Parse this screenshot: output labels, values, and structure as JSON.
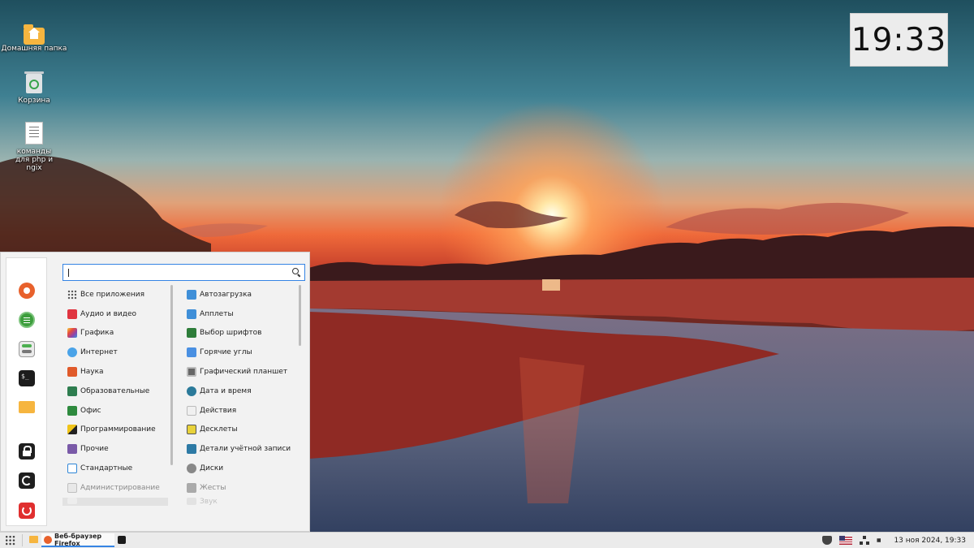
{
  "desktop": {
    "icons": [
      {
        "label": "Домашняя папка",
        "icon": "home-folder-icon"
      },
      {
        "label": "Корзина",
        "icon": "trash-icon"
      },
      {
        "label": "команды для php и ngix",
        "icon": "text-document-icon"
      }
    ],
    "clock": "19:33"
  },
  "menu": {
    "search_placeholder": "",
    "favorites": [
      {
        "name": "Firefox",
        "icon": "firefox-icon"
      },
      {
        "name": "Software Manager",
        "icon": "software-manager-icon"
      },
      {
        "name": "Settings",
        "icon": "settings-icon"
      },
      {
        "name": "Terminal",
        "icon": "terminal-icon"
      },
      {
        "name": "Files",
        "icon": "folder-icon"
      },
      {
        "name": "Lock",
        "icon": "lock-icon"
      },
      {
        "name": "Log out",
        "icon": "logout-icon"
      },
      {
        "name": "Quit",
        "icon": "power-icon"
      }
    ],
    "categories": [
      {
        "label": "Все приложения",
        "icon": "grid-icon",
        "color": "#555555"
      },
      {
        "label": "Аудио и видео",
        "icon": "multimedia-icon",
        "color": "#e0343f"
      },
      {
        "label": "Графика",
        "icon": "graphics-icon",
        "color": "#c86bd6"
      },
      {
        "label": "Интернет",
        "icon": "internet-icon",
        "color": "#4aa3e8"
      },
      {
        "label": "Наука",
        "icon": "science-icon",
        "color": "#e05a2a"
      },
      {
        "label": "Образовательные",
        "icon": "education-icon",
        "color": "#2e7d4f"
      },
      {
        "label": "Офис",
        "icon": "office-icon",
        "color": "#2e8a3e"
      },
      {
        "label": "Программирование",
        "icon": "programming-icon",
        "color": "#f0c419"
      },
      {
        "label": "Прочие",
        "icon": "other-icon",
        "color": "#7a5aa8"
      },
      {
        "label": "Стандартные",
        "icon": "accessories-icon",
        "color": "#2f86d6"
      },
      {
        "label": "Администрирование",
        "icon": "administration-icon",
        "color": "#bfbfbf"
      },
      {
        "label": "",
        "icon": "preferences-icon",
        "color": "#e6e6e6"
      }
    ],
    "apps": [
      {
        "label": "Автозагрузка",
        "icon": "startup-icon",
        "color": "#3f8fd8"
      },
      {
        "label": "Апплеты",
        "icon": "applets-icon",
        "color": "#3f8fd8"
      },
      {
        "label": "Выбор шрифтов",
        "icon": "fonts-icon",
        "color": "#2e7d3a"
      },
      {
        "label": "Горячие углы",
        "icon": "hot-corners-icon",
        "color": "#4a90e2"
      },
      {
        "label": "Графический планшет",
        "icon": "tablet-icon",
        "color": "#666666"
      },
      {
        "label": "Дата и время",
        "icon": "date-time-icon",
        "color": "#2b7a9a"
      },
      {
        "label": "Действия",
        "icon": "actions-icon",
        "color": "#d9d9d9"
      },
      {
        "label": "Десклеты",
        "icon": "desklets-icon",
        "color": "#e8d23a"
      },
      {
        "label": "Детали учётной записи",
        "icon": "account-icon",
        "color": "#2d7aa5"
      },
      {
        "label": "Диски",
        "icon": "disks-icon",
        "color": "#888888"
      },
      {
        "label": "Жесты",
        "icon": "gestures-icon",
        "color": "#8a8a8a"
      },
      {
        "label": "Звук",
        "icon": "sound-icon",
        "color": "#cccccc"
      }
    ]
  },
  "taskbar": {
    "window_title": "Веб-браузер Firefox",
    "datetime": "13 ноя 2024, 19:33"
  }
}
